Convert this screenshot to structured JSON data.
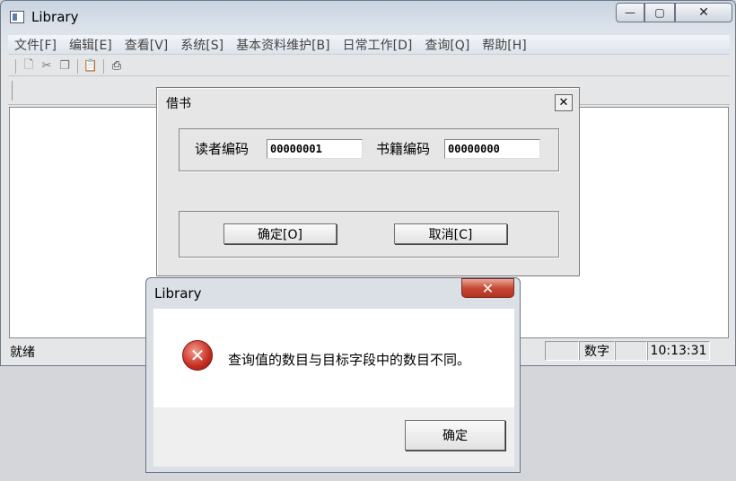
{
  "main": {
    "title": "Library",
    "caption_buttons": {
      "minimize": "—",
      "maximize": "▢",
      "close": "✕"
    },
    "menu": [
      "文件[F]",
      "编辑[E]",
      "查看[V]",
      "系统[S]",
      "基本资料维护[B]",
      "日常工作[D]",
      "查询[Q]",
      "帮助[H]"
    ],
    "status": {
      "ready": "就绪",
      "numlock": "数字",
      "time": "10:13:31"
    }
  },
  "borrow_dialog": {
    "title": "借书",
    "reader_label": "读者编码",
    "reader_value": "00000001",
    "book_label": "书籍编码",
    "book_value": "00000000",
    "ok_label": "确定[O]",
    "cancel_label": "取消[C]"
  },
  "message_box": {
    "title": "Library",
    "text": "查询值的数目与目标字段中的数目不同。",
    "ok_label": "确定",
    "icon": "error-icon"
  },
  "colors": {
    "error": "#c62d1f",
    "close_button": "#c74a35"
  }
}
